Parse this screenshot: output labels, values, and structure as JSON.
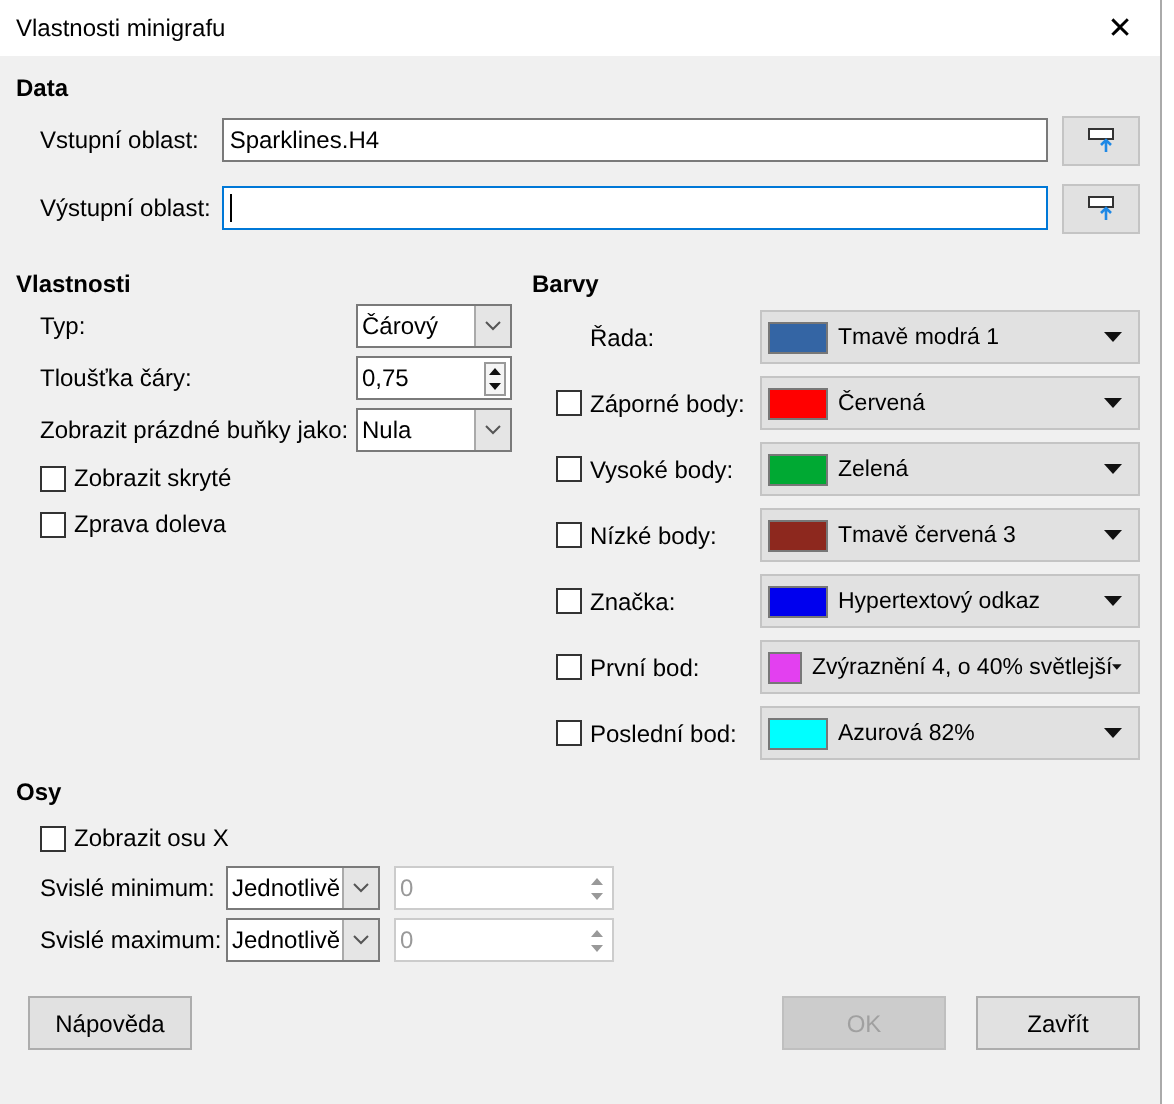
{
  "window": {
    "title": "Vlastnosti minigrafu",
    "close": "✕"
  },
  "data": {
    "heading": "Data",
    "fields": [
      {
        "label": "Vstupní oblast:",
        "value": "Sparklines.H4",
        "focused": false
      },
      {
        "label": "Výstupní oblast:",
        "focused": true
      }
    ]
  },
  "properties": {
    "heading": "Vlastnosti",
    "controls": [
      {
        "kind": "dropdown",
        "label": "Typ:",
        "value": "Čárový"
      },
      {
        "kind": "spin",
        "label": "Tloušťka čáry:",
        "value": "0,75"
      },
      {
        "kind": "dropdown",
        "label": "Zobrazit prázdné buňky jako:",
        "value": "Nula"
      }
    ],
    "checkboxes": [
      {
        "label": "Zobrazit skryté",
        "checked": false
      },
      {
        "label": "Zprava doleva",
        "checked": false
      }
    ]
  },
  "colors": {
    "heading": "Barvy",
    "rows": [
      {
        "kind": "plain",
        "label": "Řada:",
        "value": "Tmavě modrá 1",
        "color": "#3465a4"
      },
      {
        "kind": "checkbox",
        "label": "Záporné body:",
        "checked": false,
        "value": "Červená",
        "color": "#ff0000"
      },
      {
        "kind": "checkbox",
        "label": "Vysoké body:",
        "checked": false,
        "value": "Zelená",
        "color": "#00a933"
      },
      {
        "kind": "checkbox",
        "label": "Nízké body:",
        "checked": false,
        "value": "Tmavě červená 3",
        "color": "#8d281e"
      },
      {
        "kind": "checkbox",
        "label": "Značka:",
        "checked": false,
        "value": "Hypertextový odkaz",
        "color": "#0000ee"
      },
      {
        "kind": "checkbox",
        "label": "První bod:",
        "checked": false,
        "value": "Zvýraznění 4, o 40% světlejší",
        "color": "#e340f0"
      },
      {
        "kind": "checkbox",
        "label": "Poslední bod:",
        "checked": false,
        "value": "Azurová 82%",
        "color": "#00ffff"
      }
    ]
  },
  "axes": {
    "heading": "Osy",
    "checkbox": {
      "label": "Zobrazit osu X",
      "checked": false
    },
    "rows": [
      {
        "label": "Svislé minimum:",
        "mode": "Jednotlivě",
        "value": "0",
        "disabled": true
      },
      {
        "label": "Svislé maximum:",
        "mode": "Jednotlivě",
        "value": "0",
        "disabled": true
      }
    ]
  },
  "buttons": [
    {
      "label": "Nápověda",
      "disabled": false,
      "kind": "help"
    },
    {
      "label": "OK",
      "disabled": true,
      "kind": "action"
    },
    {
      "label": "Zavřít",
      "disabled": false,
      "kind": "action"
    }
  ]
}
